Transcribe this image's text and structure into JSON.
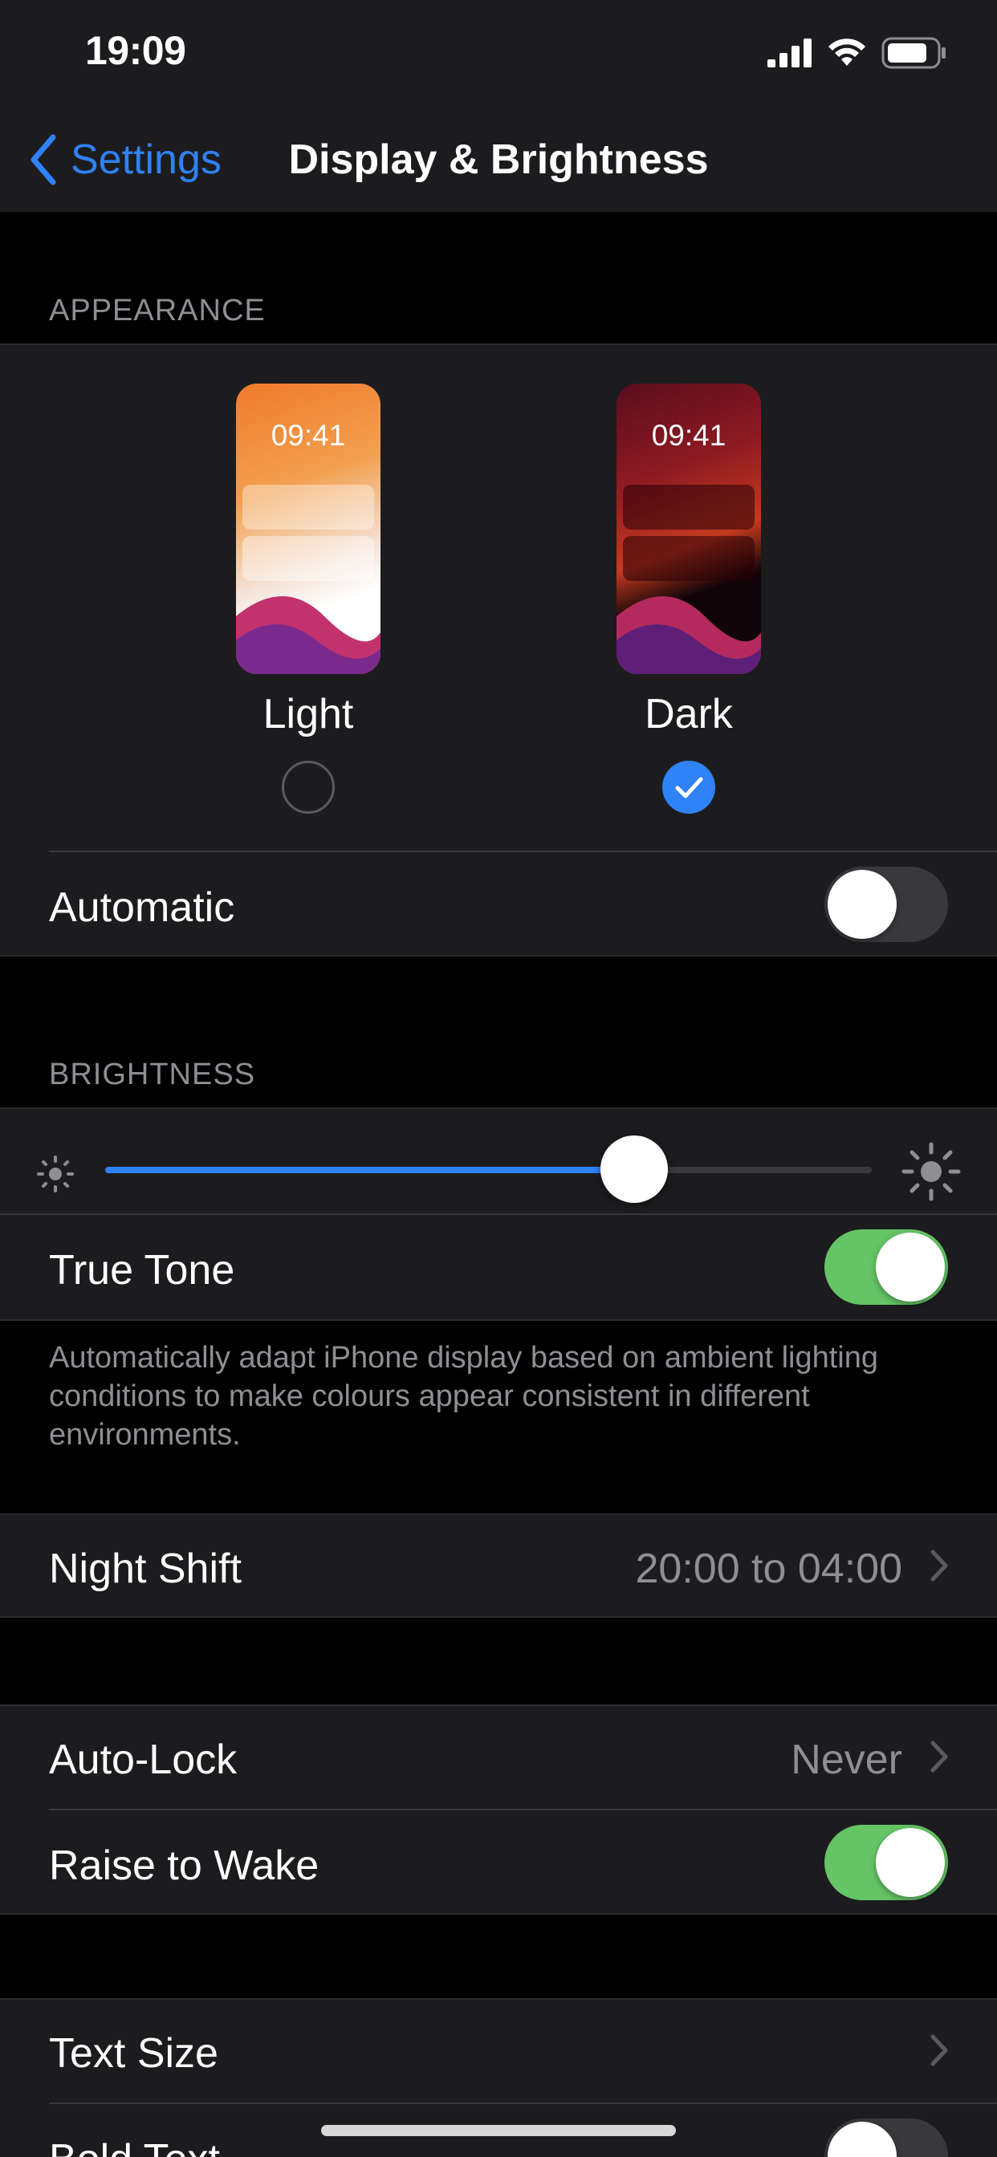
{
  "status_bar": {
    "time": "19:09",
    "icons": [
      "signal-icon",
      "wifi-icon",
      "battery-icon"
    ]
  },
  "nav": {
    "back_label": "Settings",
    "title": "Display & Brightness"
  },
  "appearance": {
    "header": "APPEARANCE",
    "options": [
      {
        "label": "Light",
        "preview_time": "09:41",
        "selected": false
      },
      {
        "label": "Dark",
        "preview_time": "09:41",
        "selected": true
      }
    ],
    "automatic": {
      "label": "Automatic",
      "on": false
    }
  },
  "brightness": {
    "header": "BRIGHTNESS",
    "level": 0.69,
    "true_tone": {
      "label": "True Tone",
      "on": true
    },
    "footer": "Automatically adapt iPhone display based on ambient lighting conditions to make colours appear consistent in different environments."
  },
  "night_shift": {
    "label": "Night Shift",
    "value": "20:00 to 04:00"
  },
  "lock": {
    "auto_lock": {
      "label": "Auto-Lock",
      "value": "Never"
    },
    "raise_to_wake": {
      "label": "Raise to Wake",
      "on": true
    }
  },
  "text": {
    "text_size": {
      "label": "Text Size"
    },
    "bold_text": {
      "label": "Bold Text",
      "on": false
    }
  },
  "colors": {
    "accent": "#2f82f7",
    "toggle_on": "#65c466",
    "group_bg": "#1c1c1e",
    "secondary_text": "#8e8e93"
  }
}
